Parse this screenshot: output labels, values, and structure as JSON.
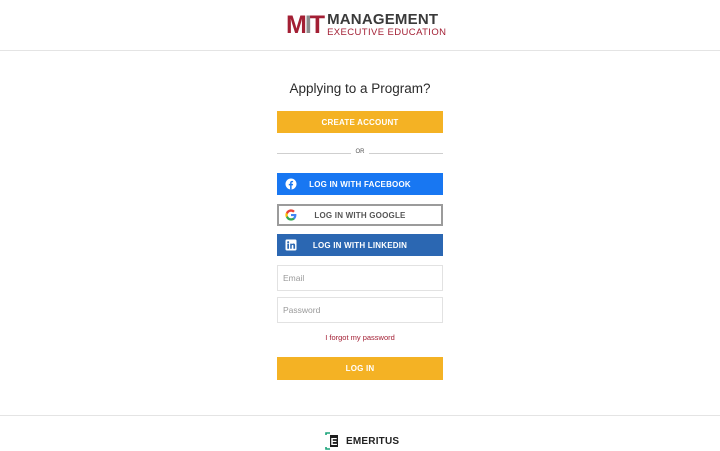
{
  "header": {
    "logo": {
      "mit_m": "M",
      "mit_i": "I",
      "mit_t": "T",
      "line1": "MANAGEMENT",
      "line2": "EXECUTIVE EDUCATION"
    }
  },
  "main": {
    "title": "Applying to a Program?",
    "create_account_label": "CREATE ACCOUNT",
    "or_label": "OR",
    "facebook_label": "LOG IN WITH FACEBOOK",
    "google_label": "LOG IN WITH GOOGLE",
    "linkedin_label": "LOG IN WITH LINKEDIN",
    "email_placeholder": "Email",
    "password_placeholder": "Password",
    "forgot_label": "I forgot my password",
    "login_label": "LOG IN"
  },
  "footer": {
    "brand_letter": "E",
    "brand_name": "EMERITUS"
  },
  "colors": {
    "accent": "#f4b224",
    "facebook": "#1877f2",
    "linkedin": "#2b67b2",
    "mit_red": "#a31f34"
  },
  "icons": {
    "facebook": "facebook-icon",
    "google": "google-icon",
    "linkedin": "linkedin-icon"
  }
}
